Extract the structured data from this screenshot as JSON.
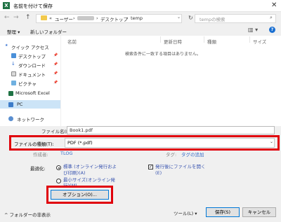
{
  "window": {
    "app_icon": "X",
    "title": "名前を付けて保存",
    "close_symbol": "✕"
  },
  "address": {
    "back_symbol": "←",
    "forward_symbol": "→",
    "up_symbol": "↑",
    "breadcrumb": [
      "«",
      "ユーザー",
      "›",
      "›",
      "デスクトップ",
      "›",
      "temp"
    ],
    "dropdown_symbol": "⌄",
    "refresh_symbol": "↻"
  },
  "search": {
    "placeholder": "tempの検索",
    "icon_symbol": "⌕"
  },
  "toolbar": {
    "organize": "整理 ▾",
    "new_folder": "新しいフォルダー",
    "view_symbol": "▥ ▾",
    "help": "?"
  },
  "nav": {
    "quick_access": "クイック アクセス",
    "desktop": "デスクトップ",
    "downloads": "ダウンロード",
    "documents": "ドキュメント",
    "pictures": "ピクチャ",
    "pin_symbol": "📌",
    "excel": "Microsoft Excel",
    "pc": "PC",
    "network": "ネットワーク"
  },
  "columns": {
    "name": "名前",
    "date": "更新日時",
    "type": "種類",
    "size": "サイズ"
  },
  "empty_message": "検索条件に一致する項目はありません。",
  "form": {
    "filename_label": "ファイル名(N):",
    "filename_value": "Book1.pdf",
    "type_label": "ファイルの種類(T):",
    "type_value": "PDF (*.pdf)",
    "type_dropdown": "⌄",
    "author_label": "作成者:",
    "author_value": "TLOG",
    "tags_label": "タグ:",
    "tags_value": "タグの追加"
  },
  "optimize": {
    "label": "最適化:",
    "standard_line1": "標準 (オンライン発行およ",
    "standard_line2": "び印刷)(A)",
    "minimum_line1": "最小サイズ(オンライン発",
    "minimum_line2": "行)(M)",
    "open_after_line1": "発行後にファイルを開く",
    "open_after_line2": "(E)",
    "check_symbol": "✓",
    "options_button": "オプション(O)..."
  },
  "footer": {
    "hide_folders": "^ フォルダーの非表示",
    "tools": "ツール(L) ▾",
    "save": "保存(S)",
    "cancel": "キャンセル"
  },
  "colors": {
    "highlight_red": "#e0000b",
    "excel_green": "#1f7244",
    "accent_blue": "#0078d7"
  }
}
